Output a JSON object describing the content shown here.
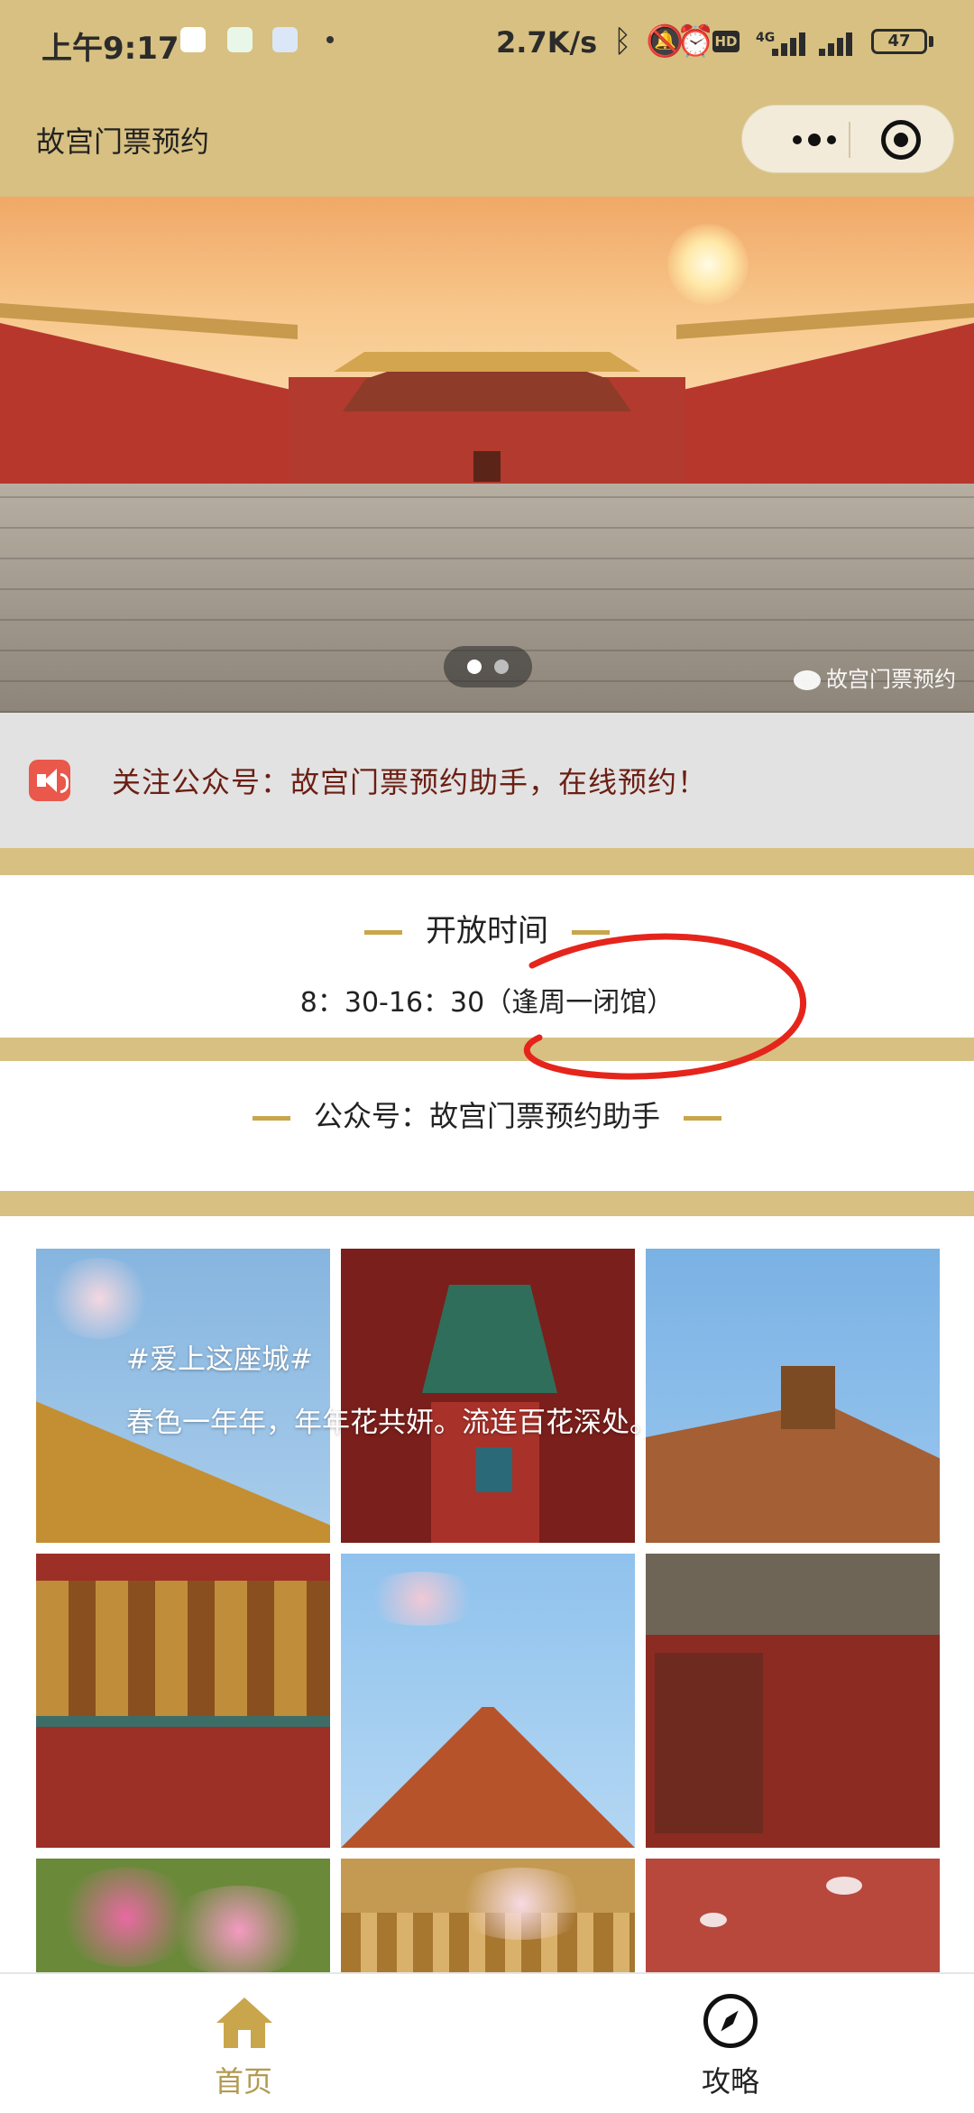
{
  "status_bar": {
    "time": "上午9:17",
    "network_speed": "2.7K/s",
    "network_type": "4G",
    "battery": "47",
    "hd_badge": "HD"
  },
  "nav": {
    "title": "故宫门票预约"
  },
  "banner": {
    "watermark": "故宫门票预约",
    "slide_count": 2,
    "active_slide": 1
  },
  "notice": {
    "text": "关注公众号：故宫门票预约助手，在线预约！"
  },
  "open_time": {
    "title": "开放时间",
    "hours": "8：30-16：30（逢周一闭馆）"
  },
  "wechat": {
    "title": "公众号：故宫门票预约助手"
  },
  "gallery": {
    "overlay_line1": "#爱上这座城#",
    "overlay_line2": "春色一年年，年年花共妍。流连百花深处。"
  },
  "tabbar": {
    "items": [
      {
        "label": "首页",
        "icon": "home-icon",
        "active": true
      },
      {
        "label": "攻略",
        "icon": "compass-icon",
        "active": false
      }
    ]
  },
  "colors": {
    "header_gold": "#d7c081",
    "accent_gold": "#c9a64b",
    "notice_text": "#6b1f14",
    "notice_icon": "#e9584b",
    "annotation_red": "#e5251c"
  }
}
